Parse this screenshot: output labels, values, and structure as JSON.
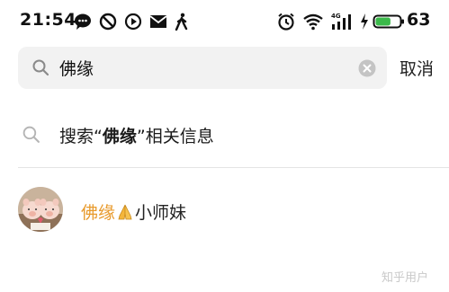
{
  "status_bar": {
    "time": "21:54",
    "network_label": "4G",
    "battery_level": "63",
    "battery_color": "#3bb94a",
    "icons": [
      "chat-bubble-icon",
      "no-disturb-icon",
      "play-icon",
      "mail-icon",
      "walking-icon",
      "alarm-icon",
      "wifi-icon",
      "signal-icon",
      "charging-icon",
      "battery-icon"
    ]
  },
  "search": {
    "query": "佛缘",
    "cancel_label": "取消"
  },
  "suggestion": {
    "prefix": "搜索“",
    "keyword": "佛缘",
    "suffix": "”相关信息"
  },
  "user_result": {
    "name_highlight": "佛缘",
    "name_rest": "小师妹",
    "highlight_color": "#e89a2c",
    "emoji": "praying-hands-icon"
  },
  "watermark": "知乎用户"
}
